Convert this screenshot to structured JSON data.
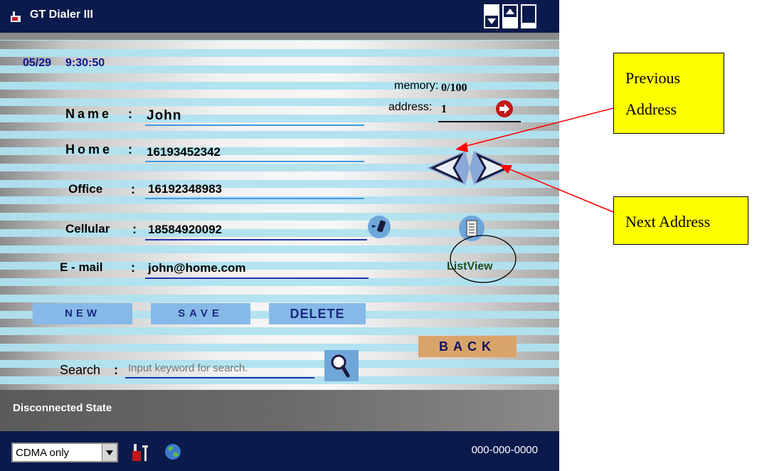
{
  "window": {
    "title": "GT Dialer III"
  },
  "header": {
    "date": "05/29",
    "time": "9:30:50"
  },
  "memory": {
    "memory_label": "memory:",
    "memory_value": "0/100",
    "address_label": "address:",
    "address_value": "1"
  },
  "form": {
    "fields": [
      {
        "label": "Name",
        "colon": ":",
        "value": "John"
      },
      {
        "label": "Home",
        "colon": ":",
        "value": "16193452342"
      },
      {
        "label": "Office",
        "colon": ":",
        "value": "16192348983"
      },
      {
        "label": "Cellular",
        "colon": ":",
        "value": "18584920092"
      },
      {
        "label": "E - mail",
        "colon": ":",
        "value": "john@home.com"
      }
    ]
  },
  "buttons": {
    "new": "NEW",
    "save": "SAVE",
    "delete": "DELETE",
    "back": "BACK",
    "listview": "ListView"
  },
  "search": {
    "label": "Search",
    "colon": ":",
    "placeholder": "Input keyword for search."
  },
  "status": {
    "text": "Disconnected State"
  },
  "bottom": {
    "network_mode": "CDMA only",
    "phone_number": "000-000-0000"
  },
  "callouts": {
    "previous_line1": "Previous",
    "previous_line2": "Address",
    "next": "Next Address"
  },
  "colors": {
    "title_bg": "#0a1a4c",
    "button_bg": "#86b9e7",
    "button_text": "#1a2980",
    "back_bg": "#d9a46a",
    "callout_bg": "#ffff00",
    "arrow": "#ff0000"
  },
  "icons": [
    "app-icon",
    "minimize-icon",
    "restore-icon",
    "maximize-icon",
    "go-address-icon",
    "previous-arrow-icon",
    "next-arrow-icon",
    "call-phone-icon",
    "list-view-icon",
    "search-icon",
    "settings-tools-icon",
    "globe-icon",
    "dropdown-arrow-icon"
  ]
}
